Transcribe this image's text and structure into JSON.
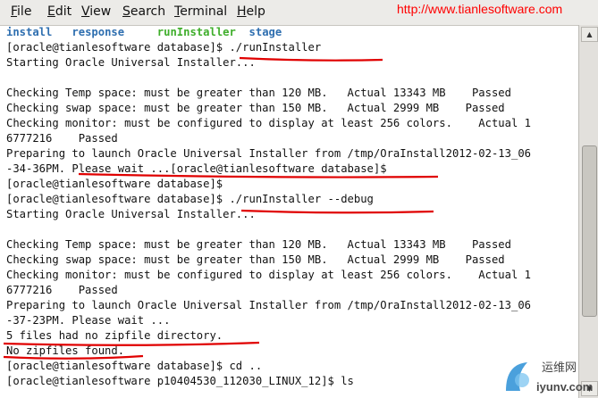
{
  "menu": [
    {
      "mnemonic": "F",
      "rest": "ile"
    },
    {
      "mnemonic": "E",
      "rest": "dit"
    },
    {
      "mnemonic": "V",
      "rest": "iew"
    },
    {
      "mnemonic": "S",
      "rest": "earch"
    },
    {
      "mnemonic": "T",
      "rest": "erminal"
    },
    {
      "mnemonic": "H",
      "rest": "elp"
    }
  ],
  "watermark": {
    "url": "http://www.tianlesoftware.com",
    "logo_chinese": "运维网",
    "logo_domain": "iyunv.com"
  },
  "terminal": {
    "ls_listing": [
      {
        "name": "install",
        "color": "#2f6fb0"
      },
      {
        "name": "response",
        "color": "#2f6fb0"
      },
      {
        "name": "runInstaller",
        "color": "#3fae2b"
      },
      {
        "name": "stage",
        "color": "#2f6fb0"
      }
    ],
    "lines": [
      "[oracle@tianlesoftware database]$ ./runInstaller",
      "Starting Oracle Universal Installer...",
      "",
      "Checking Temp space: must be greater than 120 MB.   Actual 13343 MB    Passed",
      "Checking swap space: must be greater than 150 MB.   Actual 2999 MB    Passed",
      "Checking monitor: must be configured to display at least 256 colors.    Actual 1",
      "6777216    Passed",
      "Preparing to launch Oracle Universal Installer from /tmp/OraInstall2012-02-13_06",
      "-34-36PM. Please wait ...[oracle@tianlesoftware database]$",
      "[oracle@tianlesoftware database]$",
      "[oracle@tianlesoftware database]$ ./runInstaller --debug",
      "Starting Oracle Universal Installer...",
      "",
      "Checking Temp space: must be greater than 120 MB.   Actual 13343 MB    Passed",
      "Checking swap space: must be greater than 150 MB.   Actual 2999 MB    Passed",
      "Checking monitor: must be configured to display at least 256 colors.    Actual 1",
      "6777216    Passed",
      "Preparing to launch Oracle Universal Installer from /tmp/OraInstall2012-02-13_06",
      "-37-23PM. Please wait ...",
      "5 files had no zipfile directory.",
      "No zipfiles found.",
      "[oracle@tianlesoftware database]$ cd ..",
      "[oracle@tianlesoftware p10404530_112030_LINUX_12]$ ls"
    ]
  },
  "colors": {
    "annotation": "#e00000",
    "text": "#111111",
    "menubar": "#ecebe8"
  }
}
